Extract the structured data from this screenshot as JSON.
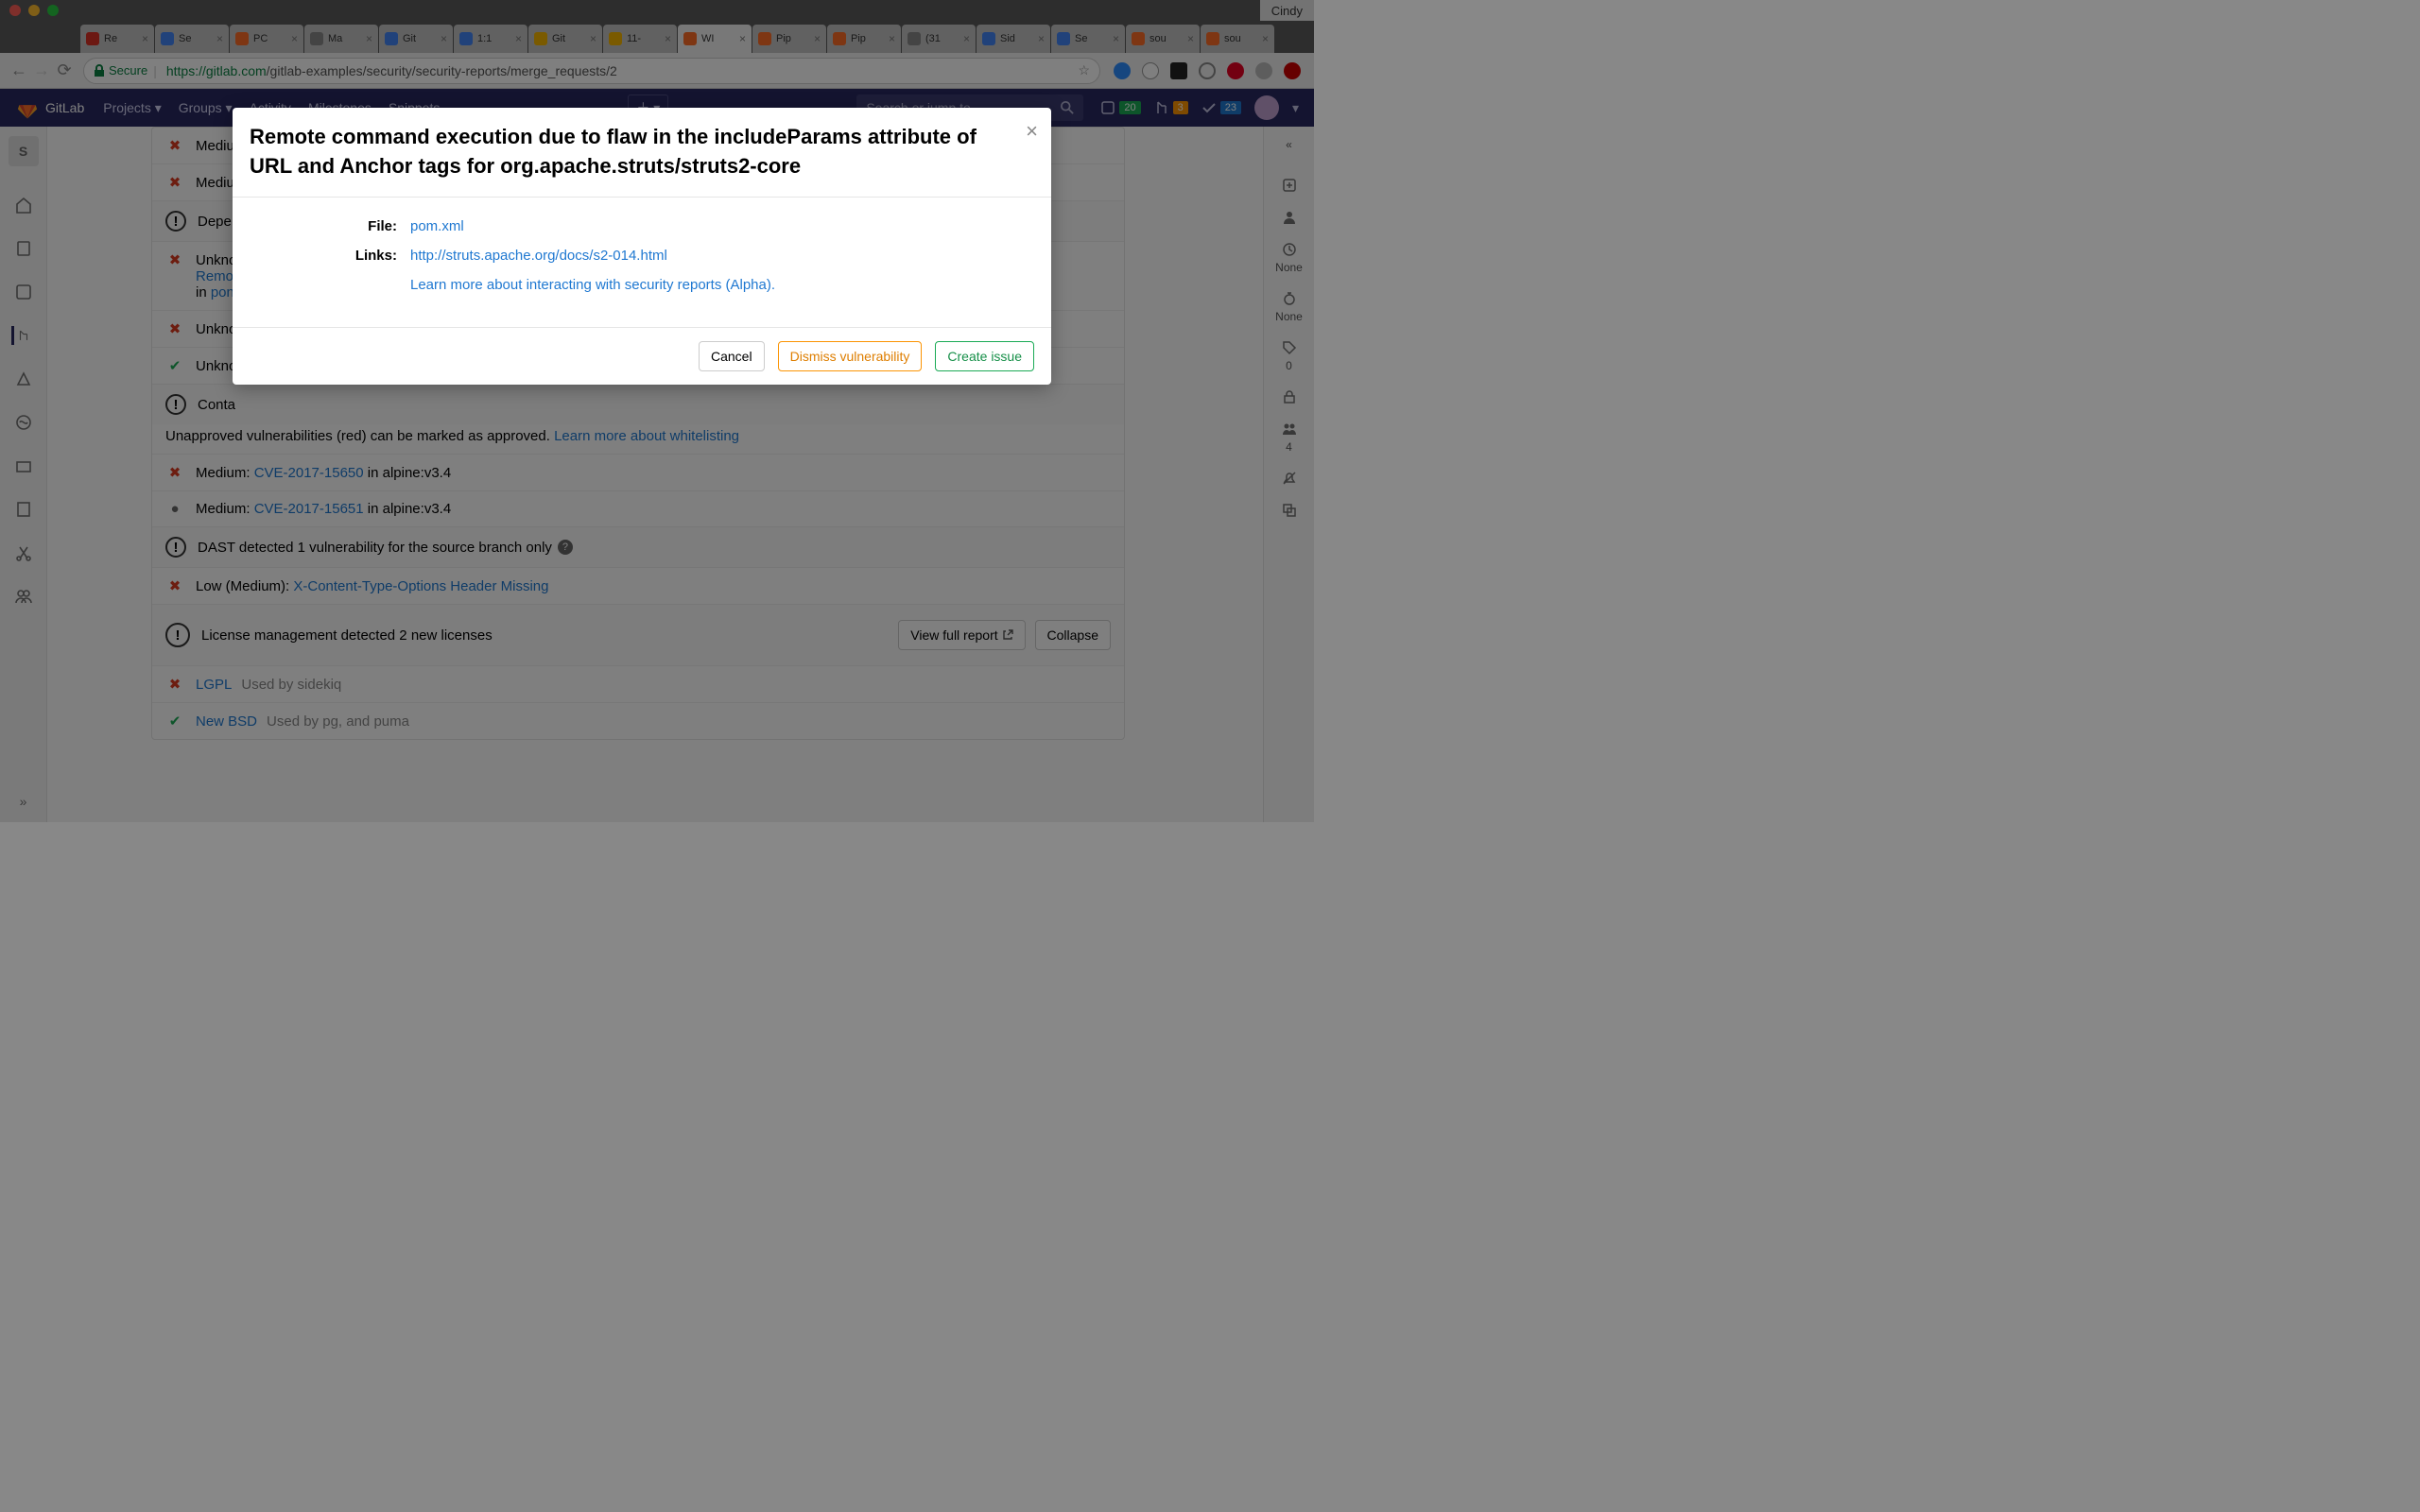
{
  "chrome": {
    "profile": "Cindy",
    "tabs": [
      {
        "label": "Re",
        "fav": "gmail"
      },
      {
        "label": "Se",
        "fav": "gdocs"
      },
      {
        "label": "PC",
        "fav": "gitlab"
      },
      {
        "label": "Ma",
        "fav": "trello"
      },
      {
        "label": "Git",
        "fav": "gcal"
      },
      {
        "label": "1:1",
        "fav": "gdocs"
      },
      {
        "label": "Git",
        "fav": "gslides"
      },
      {
        "label": "11-",
        "fav": "gslides"
      },
      {
        "label": "WI",
        "fav": "gitlab",
        "active": true
      },
      {
        "label": "Pip",
        "fav": "gitlab"
      },
      {
        "label": "Pip",
        "fav": "gitlab"
      },
      {
        "label": "(31",
        "fav": "mail"
      },
      {
        "label": "Sid",
        "fav": "gdocs"
      },
      {
        "label": "Se",
        "fav": "gdocs"
      },
      {
        "label": "sou",
        "fav": "gitlab"
      },
      {
        "label": "sou",
        "fav": "gitlab"
      }
    ],
    "secure_label": "Secure",
    "url_host": "https://gitlab.com",
    "url_path": "/gitlab-examples/security/security-reports/merge_requests/2"
  },
  "gl_header": {
    "brand": "GitLab",
    "menu": [
      "Projects",
      "Groups",
      "Activity",
      "Milestones",
      "Snippets"
    ],
    "search_placeholder": "Search or jump to...",
    "issues": "20",
    "mrs": "3",
    "todos": "23"
  },
  "left_nav": {
    "project_letter": "S"
  },
  "right_aside": {
    "none1": "None",
    "none2": "None",
    "tags": "0",
    "participants": "4"
  },
  "reports": {
    "medium1": "Mediu",
    "medium2": "Mediu",
    "dep_header": "Depe",
    "unk1": "Unkno",
    "remo_link": "Remo",
    "in_label": "in ",
    "pom_link": "pon",
    "unk2": "Unkno",
    "unk3": "Unkno",
    "cont_header": "Conta",
    "whitelist_text": "Unapproved vulnerabilities (red) can be marked as approved. ",
    "whitelist_link": "Learn more about whitelisting",
    "cve1_pre": "Medium: ",
    "cve1_link": "CVE-2017-15650",
    "cve1_post": " in alpine:v3.4",
    "cve2_pre": "Medium: ",
    "cve2_link": "CVE-2017-15651",
    "cve2_post": " in alpine:v3.4",
    "dast_header": "DAST detected 1 vulnerability for the source branch only",
    "dast_item_pre": "Low (Medium): ",
    "dast_item_link": "X-Content-Type-Options Header Missing",
    "lic_header": "License management detected 2 new licenses",
    "view_full": "View full report",
    "collapse": "Collapse",
    "lic1_name": "LGPL",
    "lic1_used": "Used by sidekiq",
    "lic2_name": "New BSD",
    "lic2_used": "Used by pg, and puma"
  },
  "modal": {
    "title": "Remote command execution due to flaw in the includeParams attribute of URL and Anchor tags for org.apache.struts/struts2-core",
    "file_label": "File:",
    "file_value": "pom.xml",
    "links_label": "Links:",
    "links_value": "http://struts.apache.org/docs/s2-014.html",
    "learn_more": "Learn more about interacting with security reports (Alpha).",
    "cancel": "Cancel",
    "dismiss": "Dismiss vulnerability",
    "create": "Create issue"
  }
}
